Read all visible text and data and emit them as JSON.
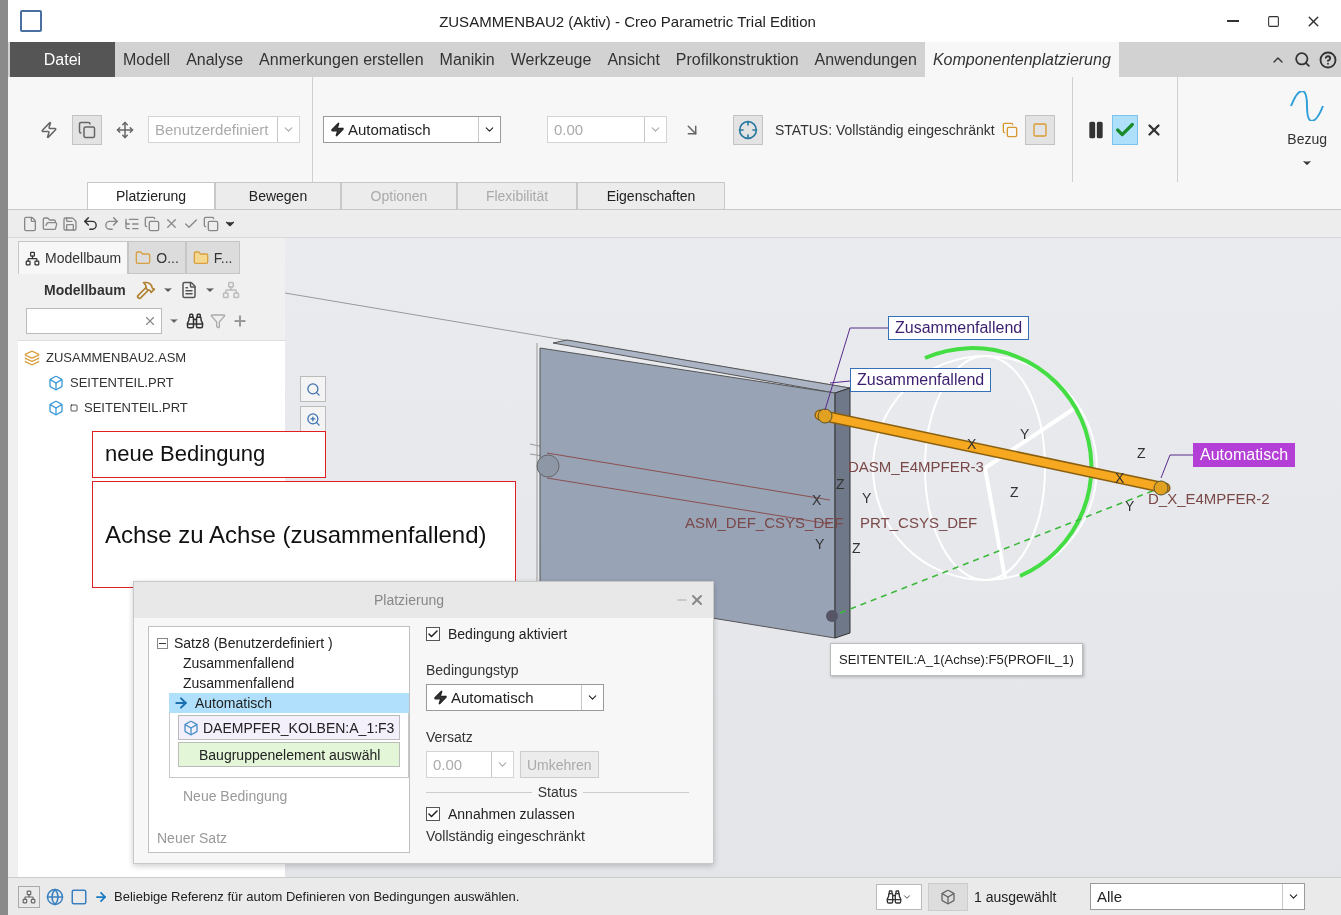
{
  "window": {
    "title": "ZUSAMMENBAU2 (Aktiv) - Creo Parametric Trial Edition"
  },
  "menu_tabs": [
    {
      "label": "Datei",
      "kind": "file",
      "selected": false
    },
    {
      "label": "Modell",
      "kind": "tab",
      "selected": false
    },
    {
      "label": "Analyse",
      "kind": "tab",
      "selected": false
    },
    {
      "label": "Anmerkungen erstellen",
      "kind": "tab",
      "selected": false
    },
    {
      "label": "Manikin",
      "kind": "tab",
      "selected": false
    },
    {
      "label": "Werkzeuge",
      "kind": "tab",
      "selected": false
    },
    {
      "label": "Ansicht",
      "kind": "tab",
      "selected": false
    },
    {
      "label": "Profilkonstruktion",
      "kind": "tab",
      "selected": false
    },
    {
      "label": "Anwendungen",
      "kind": "tab",
      "selected": false
    },
    {
      "label": "Komponentenplatzierung",
      "kind": "tab",
      "selected": true
    }
  ],
  "ribbon": {
    "constraint_set": {
      "value": "Benutzerdefiniert",
      "disabled": true
    },
    "constraint_type": {
      "value": "Automatisch",
      "disabled": false
    },
    "offset": {
      "value": "0.00",
      "disabled": true
    },
    "status": "STATUS: Vollständig eingeschränkt",
    "datum": "Bezug"
  },
  "sub_tabs": [
    {
      "label": "Platzierung",
      "selected": true,
      "disabled": false
    },
    {
      "label": "Bewegen",
      "selected": false,
      "disabled": false
    },
    {
      "label": "Optionen",
      "selected": false,
      "disabled": true
    },
    {
      "label": "Flexibilität",
      "selected": false,
      "disabled": true
    },
    {
      "label": "Eigenschaften",
      "selected": false,
      "disabled": false
    }
  ],
  "model_tree": {
    "tabs": [
      {
        "label": "Modellbaum",
        "selected": true
      },
      {
        "label": "O...",
        "selected": false
      },
      {
        "label": "F...",
        "selected": false
      }
    ],
    "heading": "Modellbaum",
    "items": [
      {
        "label": "ZUSAMMENBAU2.ASM",
        "kind": "assembly",
        "children": [
          {
            "label": "SEITENTEIL.PRT",
            "kind": "part"
          },
          {
            "label": "SEITENTEIL.PRT",
            "kind": "part-flagged"
          }
        ]
      }
    ]
  },
  "viewport": {
    "callouts": [
      {
        "text": "Zusammenfallend",
        "kind": "constraint"
      },
      {
        "text": "Zusammenfallend",
        "kind": "constraint"
      },
      {
        "text": "Automatisch",
        "kind": "active"
      }
    ],
    "labels": [
      "DASM_E4MPFER-3",
      "D_X_E4MPFER-2",
      "ASM_DEF_CSYS_DEF",
      "PRT_CSYS_DEF"
    ],
    "axis_letters": [
      "Z",
      "X",
      "Y",
      "Y",
      "Z",
      "X",
      "Y",
      "Z",
      "Z",
      "X",
      "Y"
    ],
    "tooltip": "SEITENTEIL:A_1(Achse):F5(PROFIL_1)"
  },
  "annotations": [
    {
      "text": "neue Bedingung",
      "kind": "small"
    },
    {
      "text": "Achse zu Achse (zusammenfallend)",
      "kind": "large"
    }
  ],
  "placement_dialog": {
    "title": "Platzierung",
    "set": {
      "label": "Satz8 (Benutzerdefiniert )",
      "expanded": true
    },
    "constraints": [
      {
        "label": "Zusammenfallend",
        "selected": false
      },
      {
        "label": "Zusammenfallend",
        "selected": false
      },
      {
        "label": "Automatisch",
        "selected": true
      }
    ],
    "references": [
      {
        "label": "DAEMPFER_KOLBEN:A_1:F3",
        "kind": "picked"
      },
      {
        "label": "Baugruppenelement auswähl",
        "kind": "prompt"
      }
    ],
    "new_constraint": "Neue Bedingung",
    "new_set": "Neuer Satz",
    "enabled": {
      "label": "Bedingung aktiviert",
      "checked": true
    },
    "type_label": "Bedingungstyp",
    "type_value": "Automatisch",
    "offset_label": "Versatz",
    "offset_value": "0.00",
    "flip": "Umkehren",
    "status_label": "Status",
    "assumptions": {
      "label": "Annahmen zulassen",
      "checked": true
    },
    "status_text": "Vollständig eingeschränkt"
  },
  "status_bar": {
    "message": "Beliebige Referenz für autom Definieren von Bedingungen auswählen.",
    "selection": "1 ausgewählt",
    "filter": "Alle"
  }
}
